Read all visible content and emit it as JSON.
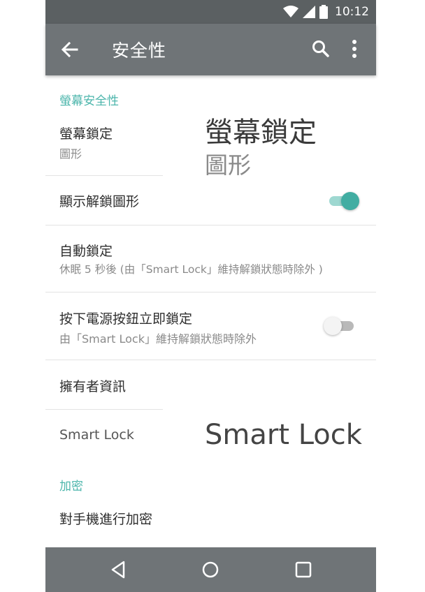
{
  "status_bar": {
    "time": "10:12",
    "icons": [
      "wifi-icon",
      "signal-icon",
      "battery-icon"
    ]
  },
  "app_bar": {
    "title": "安全性",
    "back_icon": "back-arrow-icon",
    "search_icon": "search-icon",
    "more_icon": "more-vert-icon"
  },
  "sections": {
    "screen_security": {
      "header": "螢幕安全性"
    },
    "encryption": {
      "header": "加密"
    }
  },
  "items": {
    "screen_lock": {
      "title": "螢幕鎖定",
      "summary": "圖形"
    },
    "show_pattern": {
      "title": "顯示解鎖圖形",
      "checked": true
    },
    "auto_lock": {
      "title": "自動鎖定",
      "summary": "休眠 5 秒後 (由「Smart Lock」維持解鎖狀態時除外 )"
    },
    "power_lock": {
      "title": "按下電源按鈕立即鎖定",
      "summary": "由「Smart Lock」維持解鎖狀態時除外",
      "checked": false
    },
    "owner_info": {
      "title": "擁有者資訊"
    },
    "smart_lock": {
      "title": "Smart Lock"
    },
    "encrypt_phone": {
      "title": "對手機進行加密"
    }
  },
  "callouts": {
    "screen_lock_title": "螢幕鎖定",
    "screen_lock_summary": "圖形",
    "smart_lock": "Smart Lock"
  },
  "nav_bar": {
    "icons": [
      "back-triangle-icon",
      "home-circle-icon",
      "recents-square-icon"
    ]
  },
  "colors": {
    "accent": "#4db6ac",
    "toolbar": "#6f7477",
    "statusbar": "#5b6062",
    "toggle_on": "#41ada2"
  }
}
